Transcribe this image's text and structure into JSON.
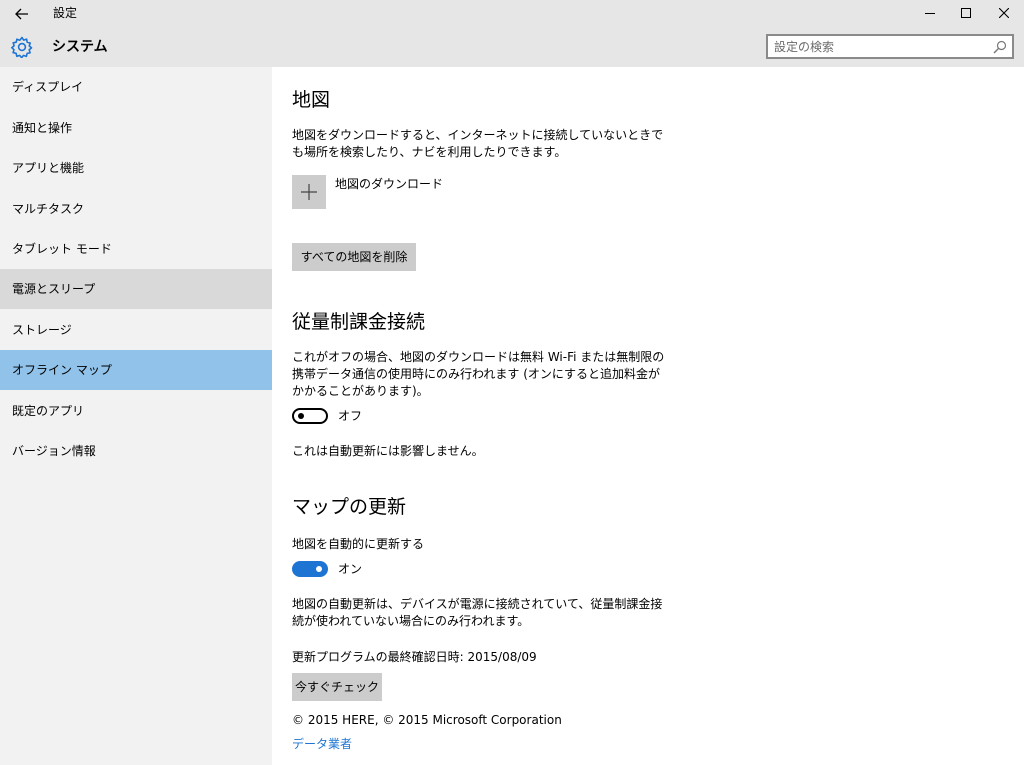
{
  "titlebar": {
    "back_icon": "back-arrow-icon",
    "title": "設定",
    "minimize_glyph": "—",
    "maximize_glyph": "☐",
    "close_glyph": "✕"
  },
  "header": {
    "icon": "gear-icon",
    "title": "システム",
    "search_placeholder": "設定の検索"
  },
  "sidebar": {
    "items": [
      {
        "label": "ディスプレイ"
      },
      {
        "label": "通知と操作"
      },
      {
        "label": "アプリと機能"
      },
      {
        "label": "マルチタスク"
      },
      {
        "label": "タブレット モード"
      },
      {
        "label": "電源とスリープ",
        "state": "hover"
      },
      {
        "label": "ストレージ"
      },
      {
        "label": "オフライン マップ",
        "state": "selected"
      },
      {
        "label": "既定のアプリ"
      },
      {
        "label": "バージョン情報"
      }
    ]
  },
  "content": {
    "maps": {
      "heading": "地図",
      "description": "地図をダウンロードすると、インターネットに接続していないときでも場所を検索したり、ナビを利用したりできます。",
      "download_label": "地図のダウンロード",
      "delete_all_label": "すべての地図を削除"
    },
    "metered": {
      "heading": "従量制課金接続",
      "description": "これがオフの場合、地図のダウンロードは無料 Wi-Fi または無制限の携帯データ通信の使用時にのみ行われます (オンにすると追加料金がかかることがあります)。",
      "toggle_state": "off",
      "toggle_label": "オフ",
      "note": "これは自動更新には影響しません。"
    },
    "updates": {
      "heading": "マップの更新",
      "auto_update_label": "地図を自動的に更新する",
      "toggle_state": "on",
      "toggle_label": "オン",
      "description": "地図の自動更新は、デバイスが電源に接続されていて、従量制課金接続が使われていない場合にのみ行われます。",
      "last_checked": "更新プログラムの最終確認日時: 2015/08/09",
      "check_now_label": "今すぐチェック",
      "copyright": "© 2015 HERE, © 2015 Microsoft Corporation",
      "data_provider_link": "データ業者"
    }
  },
  "colors": {
    "accent": "#1e74d2",
    "selected_nav": "#91c2e9",
    "hover_nav": "#d9d9d9",
    "sidebar_bg": "#f2f2f2",
    "header_bg": "#e6e6e6",
    "button_bg": "#cccccc"
  }
}
